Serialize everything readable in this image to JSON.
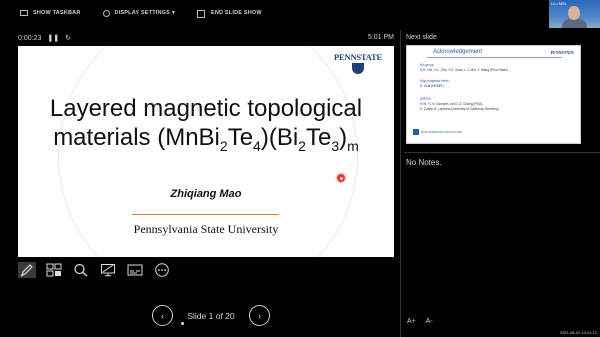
{
  "toolbar": {
    "show_taskbar": "SHOW TASKBAR",
    "display_settings": "DISPLAY SETTINGS",
    "display_settings_caret": "▾",
    "end_slide_show": "END SLIDE SHOW"
  },
  "webcam": {
    "caption": "LILI MIN"
  },
  "timer": {
    "elapsed": "0:00:23",
    "pause_icon": "pause-icon",
    "reset_icon": "reset-icon"
  },
  "clock": "5:01 PM",
  "current_slide": {
    "title_line1": "Layered magnetic topological",
    "title_line2_a": "materials (MnBi",
    "sub_2a": "2",
    "title_line2_b": "Te",
    "sub_4": "4",
    "title_line2_c": ")(Bi",
    "sub_2b": "2",
    "title_line2_d": "Te",
    "sub_3": "3",
    "title_line2_e": ")",
    "sub_m": "m",
    "author": "Zhiqiang Mao",
    "affiliation": "Pennsylvania State University",
    "logo_text": "PENNSTATE",
    "accent_color": "#e0802a",
    "logo_color": "#1e407c"
  },
  "tools": [
    "pen-icon",
    "grid-view-icon",
    "zoom-icon",
    "screen-icon",
    "subtitles-icon",
    "more-options-icon"
  ],
  "navigation": {
    "prev": "‹",
    "next": "›",
    "counter": "Slide 1 of 20"
  },
  "next_slide": {
    "label": "Next slide",
    "title": "Acknowledgement",
    "logo_text": "PENNSTATE",
    "lines": [
      {
        "text": "Mn group:",
        "kind": "h"
      },
      {
        "text": "S.H. Lee, H.L. Zhu, Y.G. Guan, L.J. Min, Y. Wang (Penn State)",
        "kind": "n"
      },
      {
        "text": "High magnetic fields:",
        "kind": "h"
      },
      {
        "text": "D. Graf (NHMFL)",
        "kind": "n"
      },
      {
        "text": "ARPES:",
        "kind": "h"
      },
      {
        "text": "H.W. Yi, N. Samarth, and C.Z. Chang (PSU)",
        "kind": "n"
      },
      {
        "text": "S. Zonjia, A. Lanzara (University of California, Berkeley)",
        "kind": "n"
      }
    ],
    "funding": "DOE SCIENCE FOR FUTURE"
  },
  "notes": {
    "text": "No Notes."
  },
  "font_controls": {
    "increase": "A+",
    "decrease": "A-"
  },
  "datestamp": "2021-08-02 14:01:12"
}
